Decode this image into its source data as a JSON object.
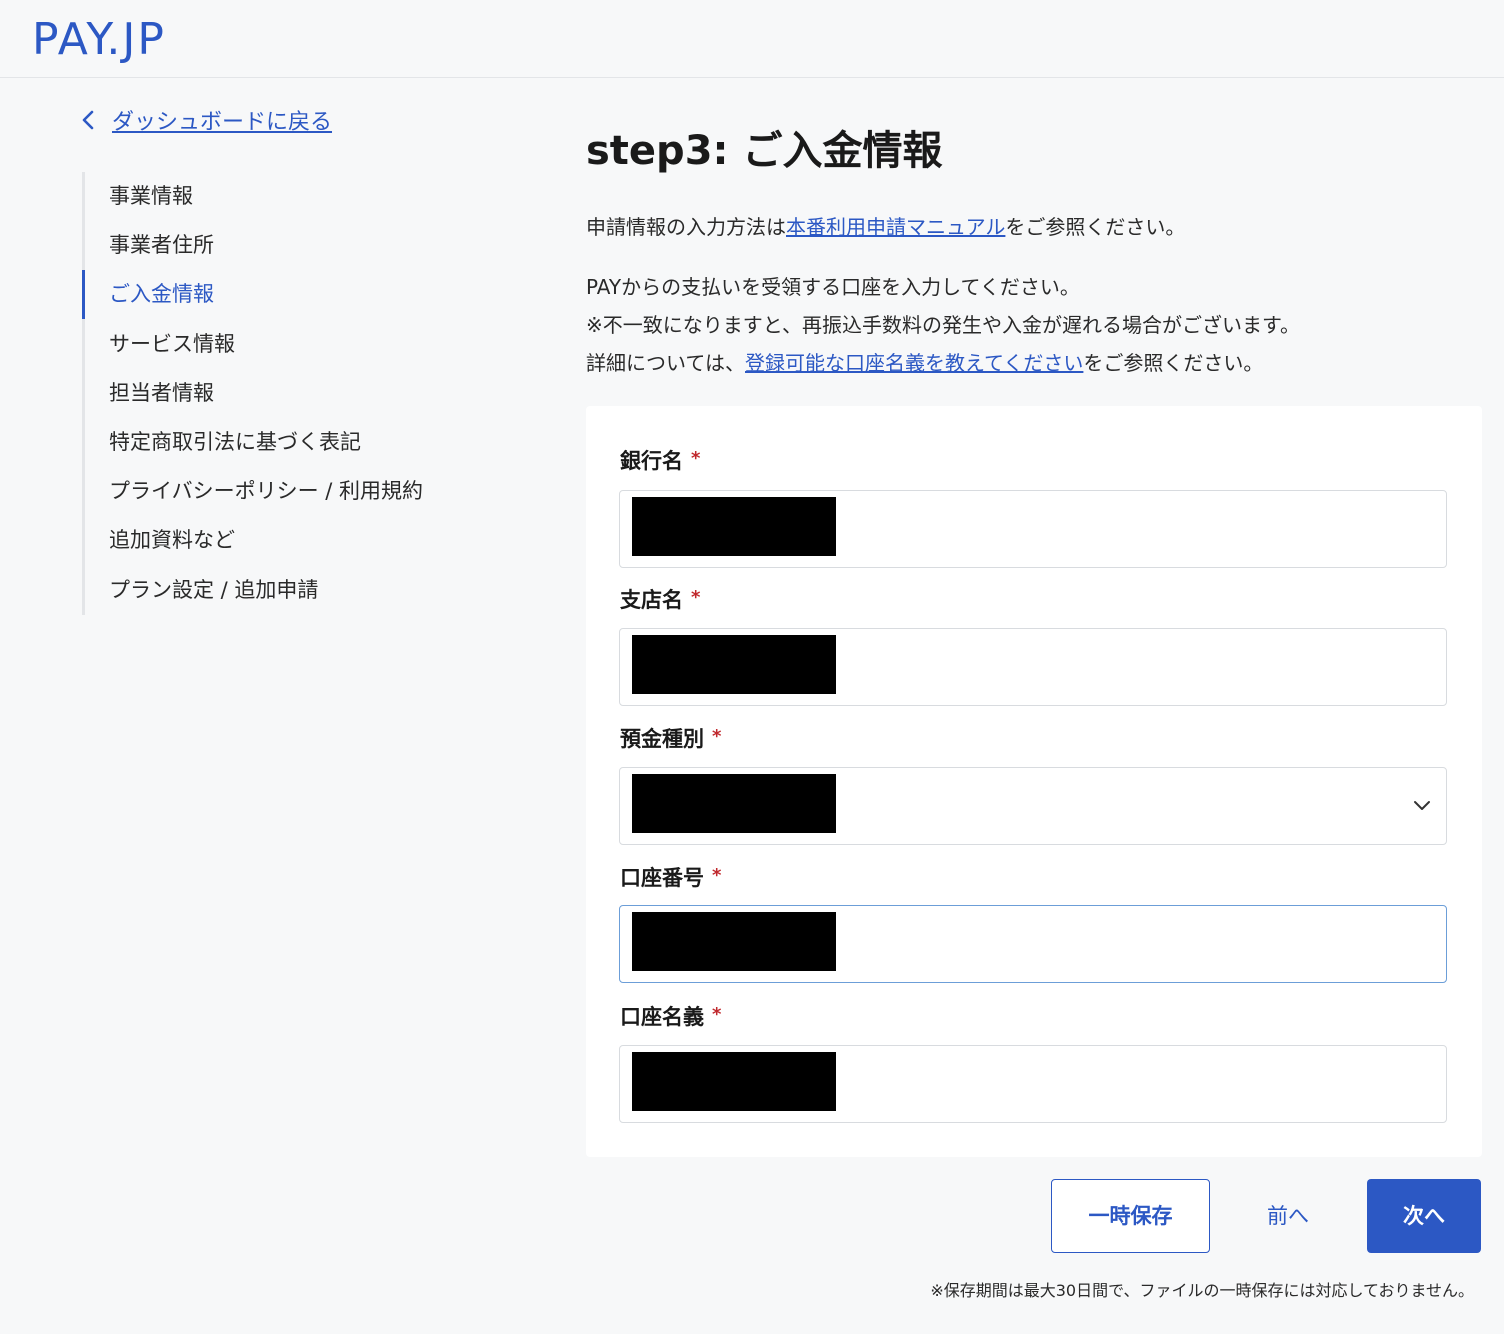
{
  "header": {
    "logo": "PAY.JP"
  },
  "back_link": {
    "label": "ダッシュボードに戻る",
    "icon": "chevron-left-icon"
  },
  "sidebar": {
    "items": [
      {
        "label": "事業情報"
      },
      {
        "label": "事業者住所"
      },
      {
        "label": "ご入金情報",
        "active": true
      },
      {
        "label": "サービス情報"
      },
      {
        "label": "担当者情報"
      },
      {
        "label": "特定商取引法に基づく表記"
      },
      {
        "label": "プライバシーポリシー / 利用規約"
      },
      {
        "label": "追加資料など"
      },
      {
        "label": "プラン設定 / 追加申請"
      }
    ]
  },
  "main": {
    "title": "step3: ご入金情報",
    "intro_prefix": "申請情報の入力方法は",
    "intro_link": "本番利用申請マニュアル",
    "intro_suffix": "をご参照ください。",
    "desc_line1": "PAYからの支払いを受領する口座を入力してください。",
    "desc_line2": "※不一致になりますと、再振込手数料の発生や入金が遅れる場合がございます。",
    "desc_line3_prefix": "詳細については、",
    "desc_line3_link": "登録可能な口座名義を教えてください",
    "desc_line3_suffix": "をご参照ください。"
  },
  "form": {
    "required_mark": "*",
    "fields": [
      {
        "label": "銀行名",
        "type": "text"
      },
      {
        "label": "支店名",
        "type": "text"
      },
      {
        "label": "預金種別",
        "type": "select"
      },
      {
        "label": "口座番号",
        "type": "text"
      },
      {
        "label": "口座名義",
        "type": "text"
      }
    ]
  },
  "actions": {
    "save_label": "一時保存",
    "prev_label": "前へ",
    "next_label": "次へ"
  },
  "footnote": "※保存期間は最大30日間で、ファイルの一時保存には対応しておりません。",
  "colors": {
    "accent": "#2c58c4",
    "required": "#c0282d"
  }
}
